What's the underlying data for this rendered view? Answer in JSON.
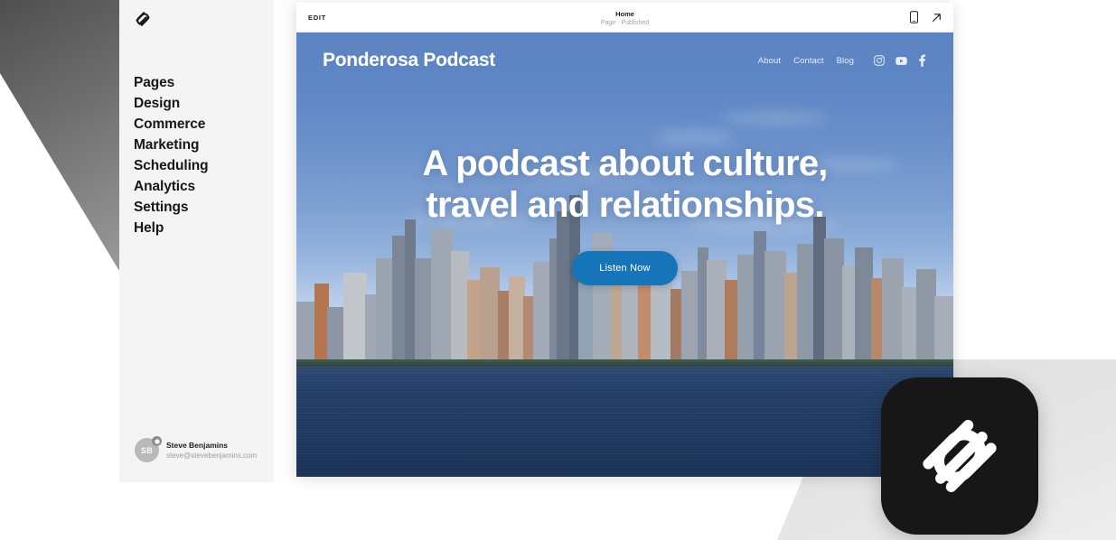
{
  "brand_logo": "squarespace-logo",
  "sidebar": {
    "items": [
      {
        "label": "Pages",
        "icon": "pages-icon"
      },
      {
        "label": "Design",
        "icon": "design-icon"
      },
      {
        "label": "Commerce",
        "icon": "commerce-icon"
      },
      {
        "label": "Marketing",
        "icon": "marketing-icon"
      },
      {
        "label": "Scheduling",
        "icon": "scheduling-icon"
      },
      {
        "label": "Analytics",
        "icon": "analytics-icon"
      },
      {
        "label": "Settings",
        "icon": "settings-icon"
      },
      {
        "label": "Help",
        "icon": "help-icon"
      }
    ],
    "account": {
      "initials": "SB",
      "name": "Steve Benjamins",
      "email": "steve@stevebenjamins.com",
      "badge_icon": "gear-icon"
    }
  },
  "preview_toolbar": {
    "edit_label": "EDIT",
    "page_title": "Home",
    "page_status": "Page · Published",
    "mobile_icon": "mobile-device-icon",
    "open_icon": "open-external-arrow-icon"
  },
  "website": {
    "brand": "Ponderosa Podcast",
    "nav": [
      {
        "label": "About"
      },
      {
        "label": "Contact"
      },
      {
        "label": "Blog"
      }
    ],
    "socials": [
      {
        "name": "instagram-icon"
      },
      {
        "name": "youtube-icon"
      },
      {
        "name": "facebook-icon"
      }
    ],
    "hero": {
      "line1": "A podcast about culture,",
      "line2": "travel and relationships.",
      "button_label": "Listen Now",
      "background": "new-york-city-skyline-photo"
    }
  },
  "app_icon": {
    "name": "squarespace-app-icon"
  },
  "colors": {
    "sidebar_bg": "#f4f4f4",
    "sky_blue": "#5b83c4",
    "button_blue": "#1675b8",
    "app_icon_bg": "#171717",
    "text_dark": "#16171a"
  }
}
